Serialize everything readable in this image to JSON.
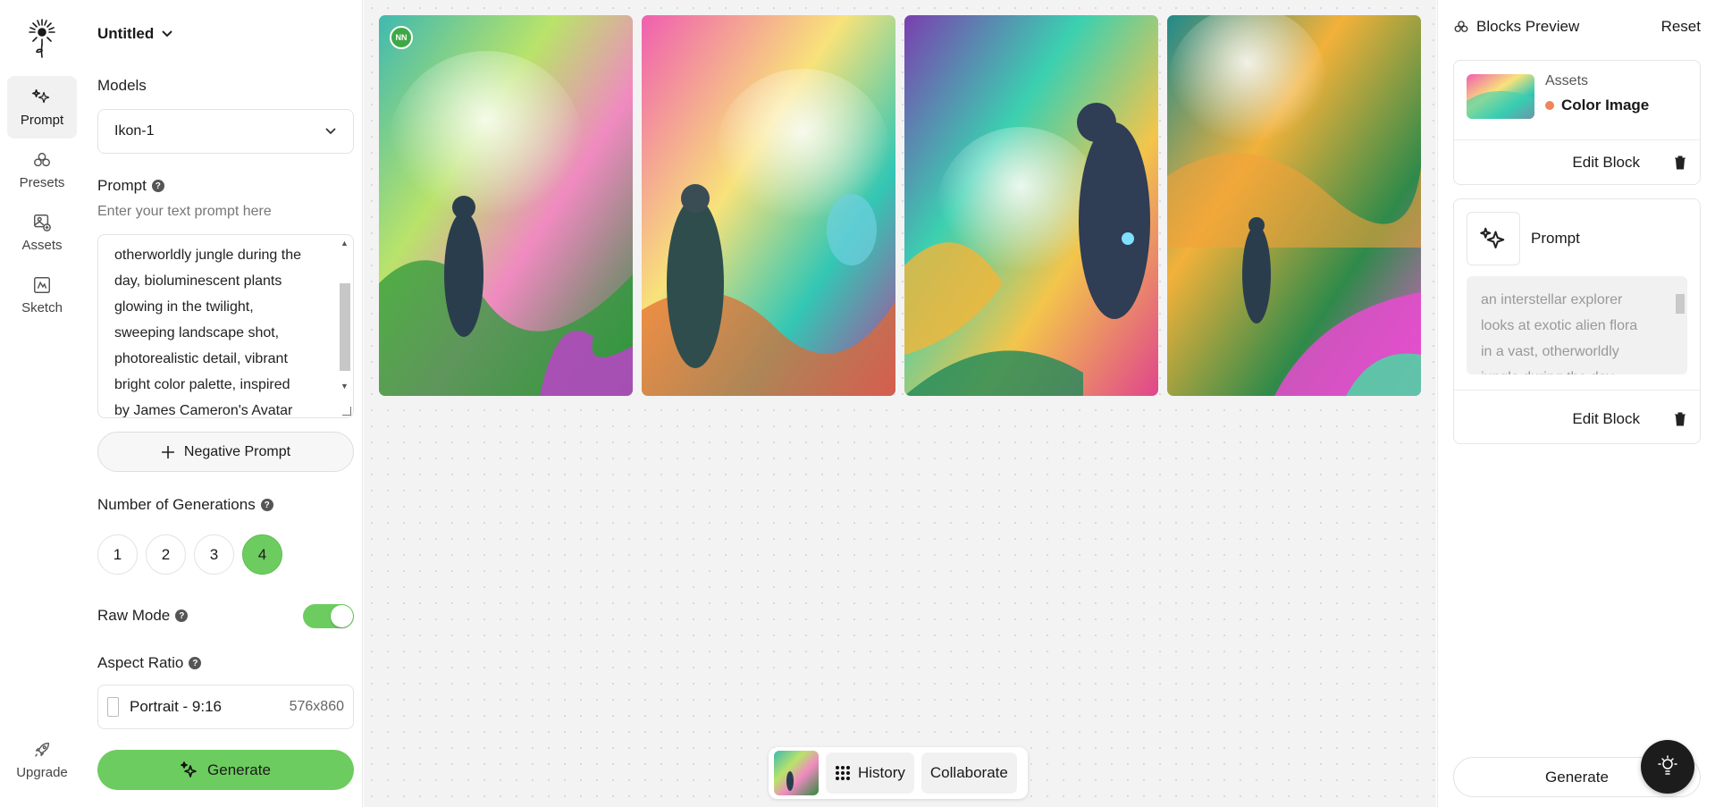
{
  "rail": {
    "items": [
      {
        "label": "Prompt",
        "icon": "prompt-sparkle-icon",
        "active": true
      },
      {
        "label": "Presets",
        "icon": "presets-icon",
        "active": false
      },
      {
        "label": "Assets",
        "icon": "assets-icon",
        "active": false
      },
      {
        "label": "Sketch",
        "icon": "sketch-icon",
        "active": false
      }
    ],
    "upgrade_label": "Upgrade"
  },
  "panel": {
    "title": "Untitled",
    "models_label": "Models",
    "model_value": "Ikon-1",
    "prompt_label": "Prompt",
    "prompt_hint": "Enter your text prompt here",
    "prompt_lines": [
      "otherworldly jungle during the",
      "day, bioluminescent plants",
      "glowing in the twilight,",
      "sweeping landscape shot,",
      "photorealistic detail, vibrant",
      "bright color palette, inspired",
      "by James Cameron's Avatar"
    ],
    "negative_prompt_label": "Negative Prompt",
    "generations_label": "Number of Generations",
    "generation_options": [
      "1",
      "2",
      "3",
      "4"
    ],
    "selected_generations": "4",
    "raw_mode_label": "Raw Mode",
    "raw_mode_on": true,
    "aspect_label": "Aspect Ratio",
    "aspect_value": "Portrait - 9:16",
    "aspect_dims": "576x860",
    "generate_label": "Generate"
  },
  "canvas": {
    "badge": "NN",
    "history_label": "History",
    "collaborate_label": "Collaborate"
  },
  "right": {
    "header": "Blocks Preview",
    "reset_label": "Reset",
    "assets_block": {
      "title": "Assets",
      "name": "Color Image",
      "edit_label": "Edit Block"
    },
    "prompt_block": {
      "title": "Prompt",
      "preview_lines": [
        "an interstellar explorer",
        "looks at exotic alien flora",
        "in a vast, otherworldly",
        "jungle during the day,"
      ],
      "edit_label": "Edit Block"
    },
    "generate_label": "Generate"
  },
  "colors": {
    "accent_green": "#6dcc5f",
    "badge_green": "#3fa846",
    "asset_dot": "#f0845a"
  }
}
